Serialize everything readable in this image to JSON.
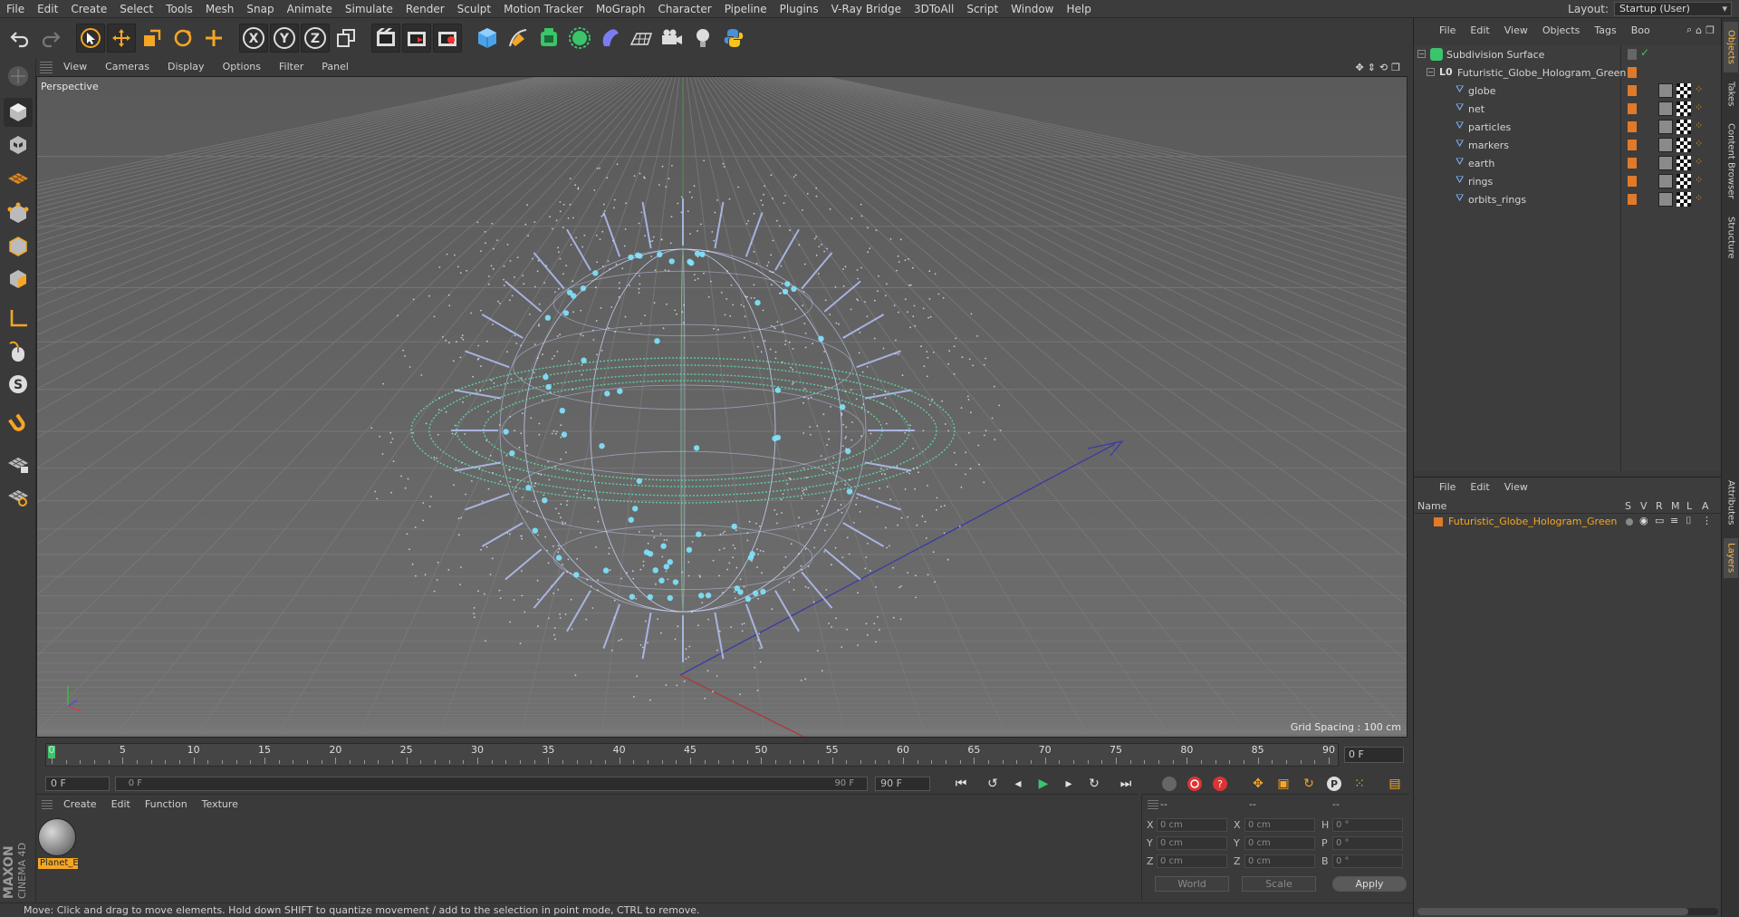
{
  "menubar": {
    "items": [
      "File",
      "Edit",
      "Create",
      "Select",
      "Tools",
      "Mesh",
      "Snap",
      "Animate",
      "Simulate",
      "Render",
      "Sculpt",
      "Motion Tracker",
      "MoGraph",
      "Character",
      "Pipeline",
      "Plugins",
      "V-Ray Bridge",
      "3DToAll",
      "Script",
      "Window",
      "Help"
    ],
    "layout_label": "Layout:",
    "layout_value": "Startup (User)"
  },
  "viewport": {
    "menu": [
      "View",
      "Cameras",
      "Display",
      "Options",
      "Filter",
      "Panel"
    ],
    "label": "Perspective",
    "grid_spacing": "Grid Spacing : 100 cm"
  },
  "timeline": {
    "ticks": [
      "0",
      "5",
      "10",
      "15",
      "20",
      "25",
      "30",
      "35",
      "40",
      "45",
      "50",
      "55",
      "60",
      "65",
      "70",
      "75",
      "80",
      "85",
      "90"
    ],
    "current_frame_box": "0 F"
  },
  "transport": {
    "start_field": "0 F",
    "range_start": "0 F",
    "range_end": "90 F",
    "end_field": "90 F"
  },
  "material_panel": {
    "menu": [
      "Create",
      "Edit",
      "Function",
      "Texture"
    ],
    "material_name": "Planet_E"
  },
  "coord_panel": {
    "header": [
      "--",
      "--",
      "--"
    ],
    "rows": [
      {
        "a": "X",
        "av": "0 cm",
        "b": "X",
        "bv": "0 cm",
        "c": "H",
        "cv": "0 °"
      },
      {
        "a": "Y",
        "av": "0 cm",
        "b": "Y",
        "bv": "0 cm",
        "c": "P",
        "cv": "0 °"
      },
      {
        "a": "Z",
        "av": "0 cm",
        "b": "Z",
        "bv": "0 cm",
        "c": "B",
        "cv": "0 °"
      }
    ],
    "world_label": "World",
    "scale_label": "Scale",
    "apply_label": "Apply"
  },
  "status": "Move: Click and drag to move elements. Hold down SHIFT to quantize movement / add to the selection in point mode, CTRL to remove.",
  "object_manager": {
    "menu": [
      "File",
      "Edit",
      "View",
      "Objects",
      "Tags",
      "Boo"
    ],
    "objects": [
      {
        "name": "Subdivision Surface",
        "indent": 0
      },
      {
        "name": "Futuristic_Globe_Hologram_Green",
        "indent": 1
      },
      {
        "name": "globe",
        "indent": 2
      },
      {
        "name": "net",
        "indent": 2
      },
      {
        "name": "particles",
        "indent": 2
      },
      {
        "name": "markers",
        "indent": 2
      },
      {
        "name": "earth",
        "indent": 2
      },
      {
        "name": "rings",
        "indent": 2
      },
      {
        "name": "orbits_rings",
        "indent": 2
      }
    ]
  },
  "layer_manager": {
    "menu": [
      "File",
      "Edit",
      "View"
    ],
    "columns": {
      "name": "Name",
      "flags": [
        "S",
        "V",
        "R",
        "M",
        "L",
        "A"
      ]
    },
    "layers": [
      {
        "name": "Futuristic_Globe_Hologram_Green",
        "color": "#e07a2a"
      }
    ]
  },
  "side_tabs": [
    "Objects",
    "Takes",
    "Content Browser",
    "Structure",
    "Attributes",
    "Layers"
  ],
  "brand": {
    "line1": "MAXON",
    "line2": "CINEMA 4D"
  },
  "colors": {
    "accent": "#f5a623",
    "layer": "#e07a2a",
    "viewport_bg": "#666666"
  }
}
